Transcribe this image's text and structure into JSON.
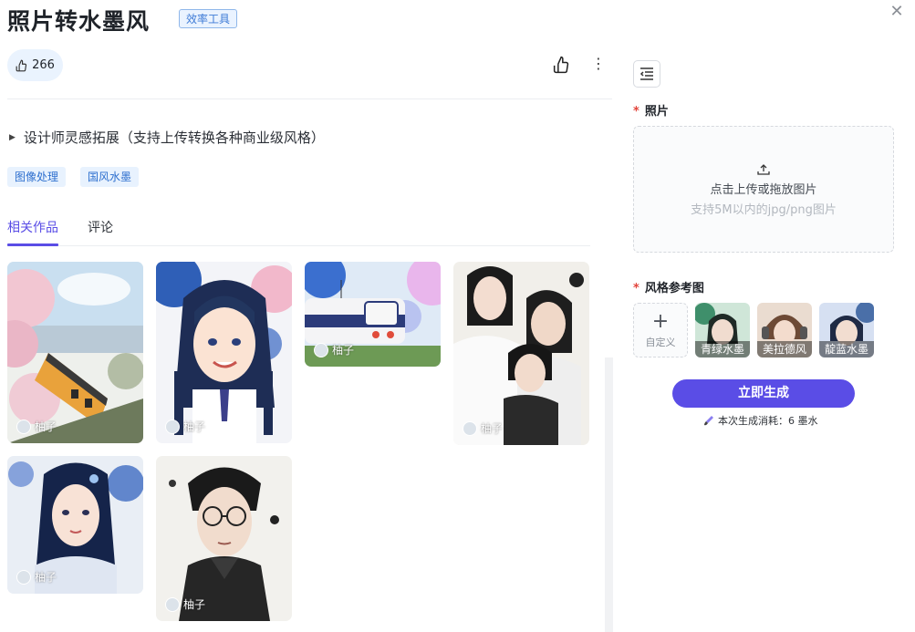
{
  "header": {
    "title": "照片转水墨风",
    "category_tag": "效率工具",
    "like_count": "266"
  },
  "description": "设计师灵感拓展（支持上传转换各种商业级风格）",
  "tags": [
    "图像处理",
    "国风水墨"
  ],
  "tabs": [
    {
      "label": "相关作品",
      "active": true
    },
    {
      "label": "评论",
      "active": false
    }
  ],
  "gallery": [
    {
      "author": "柚子",
      "subject": "cherry-blossom-train"
    },
    {
      "author": "柚子",
      "subject": "smiling-girl-braids"
    },
    {
      "author": "柚子",
      "subject": "blue-train-blossoms"
    },
    {
      "author": "柚子",
      "subject": "group-portrait"
    },
    {
      "author": "柚子",
      "subject": "girl-portrait"
    },
    {
      "author": "柚子",
      "subject": "man-with-glasses"
    }
  ],
  "form": {
    "photo_label": "照片",
    "upload_main": "点击上传或拖放图片",
    "upload_hint": "支持5M以内的jpg/png图片",
    "style_label": "风格参考图",
    "custom_label": "自定义",
    "styles": [
      {
        "label": "青绿水墨",
        "color": "#3f8f6b"
      },
      {
        "label": "美拉德风",
        "color": "#a9785a"
      },
      {
        "label": "靛蓝水墨",
        "color": "#4a6fa8"
      }
    ],
    "generate_label": "立即生成",
    "cost_text": "本次生成消耗：6 墨水"
  },
  "colors": {
    "accent": "#5a4de6",
    "required": "#e2443b",
    "tag_bg": "#e8f2fe"
  }
}
